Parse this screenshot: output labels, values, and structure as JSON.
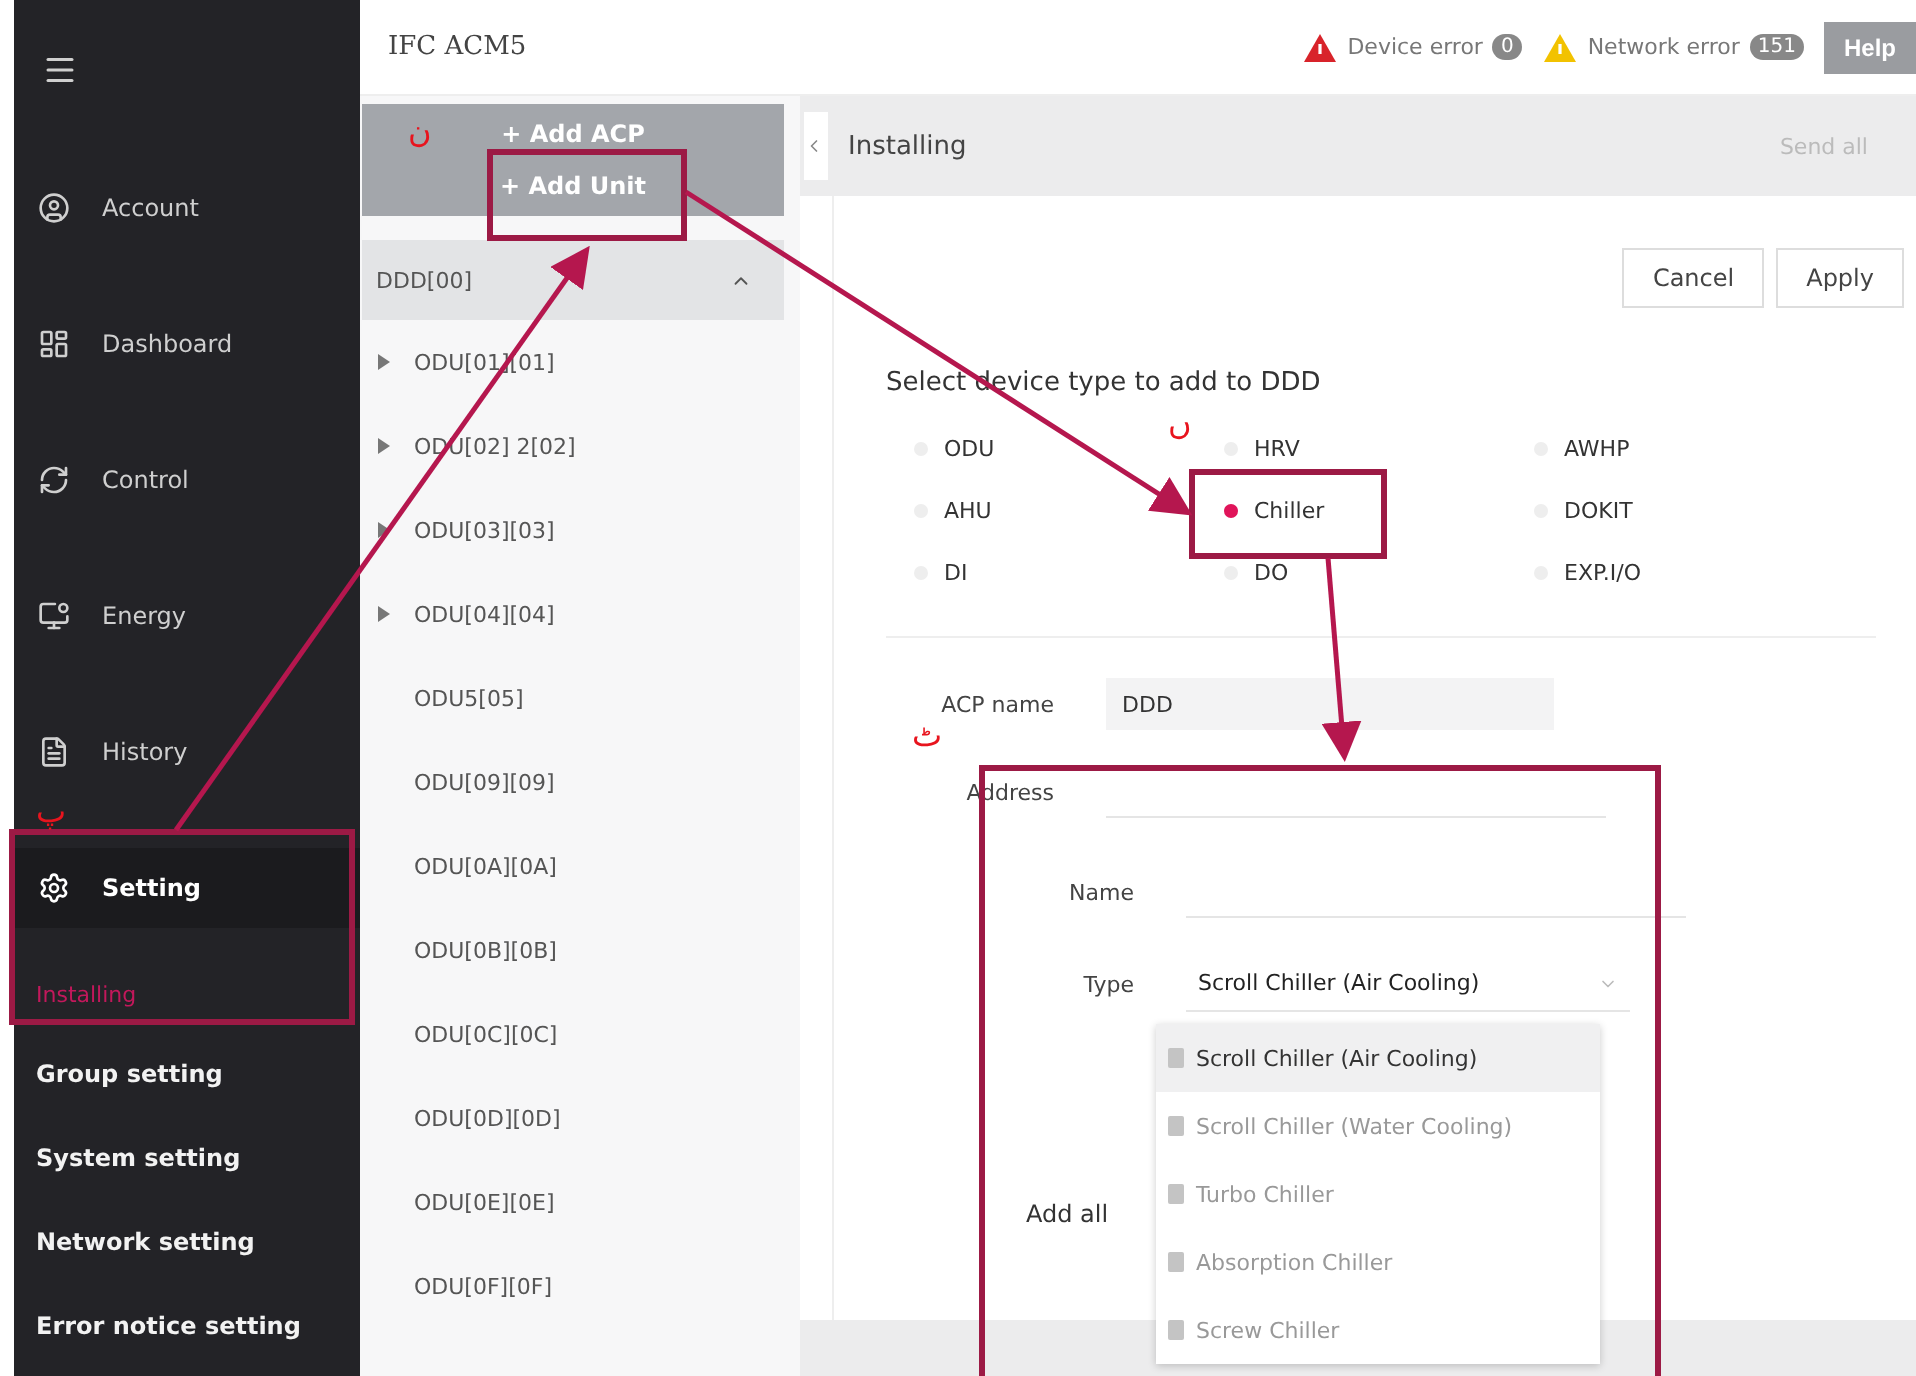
{
  "app_title": "IFC ACM5",
  "top_bar": {
    "alerts": [
      {
        "kind": "device",
        "label": "Device error",
        "count": "0"
      },
      {
        "kind": "network",
        "label": "Network error",
        "count": "151"
      }
    ],
    "help": "Help"
  },
  "sidebar": {
    "items": [
      {
        "label": "Account",
        "selected": false
      },
      {
        "label": "Dashboard",
        "selected": false
      },
      {
        "label": "Control",
        "selected": false
      },
      {
        "label": "Energy",
        "selected": false
      },
      {
        "label": "History",
        "selected": false
      },
      {
        "label": "Setting",
        "selected": true
      }
    ],
    "submenu": [
      {
        "label": "Installing",
        "selected": true
      },
      {
        "label": "Group setting",
        "selected": false
      },
      {
        "label": "System setting",
        "selected": false
      },
      {
        "label": "Network setting",
        "selected": false
      },
      {
        "label": "Error notice setting",
        "selected": false
      }
    ]
  },
  "tree": {
    "actions": [
      "+ Add ACP",
      "+ Add Unit"
    ],
    "root": "DDD[00]",
    "expanded": true,
    "children": [
      {
        "label": "ODU[01][01]",
        "expandable": true
      },
      {
        "label": "ODU[02] 2[02]",
        "expandable": true
      },
      {
        "label": "ODU[03][03]",
        "expandable": true
      },
      {
        "label": "ODU[04][04]",
        "expandable": true
      },
      {
        "label": "ODU5[05]",
        "expandable": false
      },
      {
        "label": "ODU[09][09]",
        "expandable": false
      },
      {
        "label": "ODU[0A][0A]",
        "expandable": false
      },
      {
        "label": "ODU[0B][0B]",
        "expandable": false
      },
      {
        "label": "ODU[0C][0C]",
        "expandable": false
      },
      {
        "label": "ODU[0D][0D]",
        "expandable": false
      },
      {
        "label": "ODU[0E][0E]",
        "expandable": false
      },
      {
        "label": "ODU[0F][0F]",
        "expandable": false
      }
    ]
  },
  "panel": {
    "title": "Installing",
    "send_all": "Send all",
    "buttons": [
      "Cancel",
      "Apply"
    ],
    "prompt": "Select device type to add to DDD",
    "device_types": [
      {
        "label": "ODU",
        "selected": false
      },
      {
        "label": "HRV",
        "selected": false
      },
      {
        "label": "AWHP",
        "selected": false
      },
      {
        "label": "AHU",
        "selected": false
      },
      {
        "label": "Chiller",
        "selected": true
      },
      {
        "label": "DOKIT",
        "selected": false
      },
      {
        "label": "DI",
        "selected": false
      },
      {
        "label": "DO",
        "selected": false
      },
      {
        "label": "EXP.I/O",
        "selected": false
      }
    ],
    "acp_name": {
      "label": "ACP name",
      "value": "DDD"
    },
    "fields": [
      {
        "label": "Address",
        "kind": "text"
      },
      {
        "label": "Name",
        "kind": "text"
      },
      {
        "label": "Type",
        "kind": "select",
        "value": "Scroll Chiller (Air Cooling)"
      }
    ],
    "type_options": [
      {
        "label": "Scroll Chiller (Air Cooling)",
        "selected": true
      },
      {
        "label": "Scroll Chiller (Water Cooling)",
        "selected": false
      },
      {
        "label": "Turbo Chiller",
        "selected": false
      },
      {
        "label": "Absorption Chiller",
        "selected": false
      },
      {
        "label": "Screw Chiller",
        "selected": false
      }
    ],
    "add_all": "Add all"
  },
  "annotations": [
    {
      "text": "ن"
    },
    {
      "text": "ں"
    },
    {
      "text": "ٹ"
    },
    {
      "text": "پ"
    }
  ]
}
